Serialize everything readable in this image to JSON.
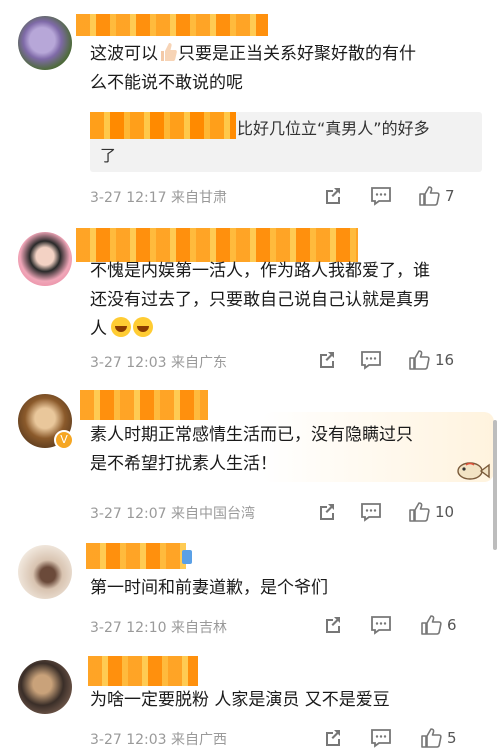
{
  "comments": [
    {
      "text": "这波可以👍🏻只要是正当关系好聚好散的有什么不能说不敢说的呢",
      "text_line1": "这波可以",
      "text_line1b": "只要是正当关系好聚好散的有什",
      "text_line2": "么不能说不敢说的呢",
      "quote_line1": "比好几位立“真男人”的好多",
      "quote_line2": "了",
      "meta": "3-27 12:17  来自甘肃",
      "likes": "7"
    },
    {
      "text_line1": "不愧是内娱第一活人，作为路人我都爱了，谁",
      "text_line2": "还没有过去了，只要敢自己说自己认就是真男",
      "text_line3": "人",
      "meta": "3-27 12:03  来自广东",
      "likes": "16"
    },
    {
      "text_line1": "素人时期正常感情生活而已，没有隐瞒过只",
      "text_line2": "是不希望打扰素人生活！",
      "meta": "3-27 12:07  来自中国台湾",
      "likes": "10"
    },
    {
      "text_line1": "第一时间和前妻道歉，是个爷们",
      "meta": "3-27 12:10  来自吉林",
      "likes": "6"
    },
    {
      "text_line1": "为啥一定要脱粉 人家是演员 又不是爱豆",
      "meta": "3-27 12:03  来自广西",
      "likes": "5"
    }
  ],
  "icons": {
    "share": "share-icon",
    "comment": "comment-icon",
    "like": "like-icon"
  },
  "colors": {
    "mask_orange": "#ff9f1a",
    "meta_gray": "#9a9a9a"
  }
}
